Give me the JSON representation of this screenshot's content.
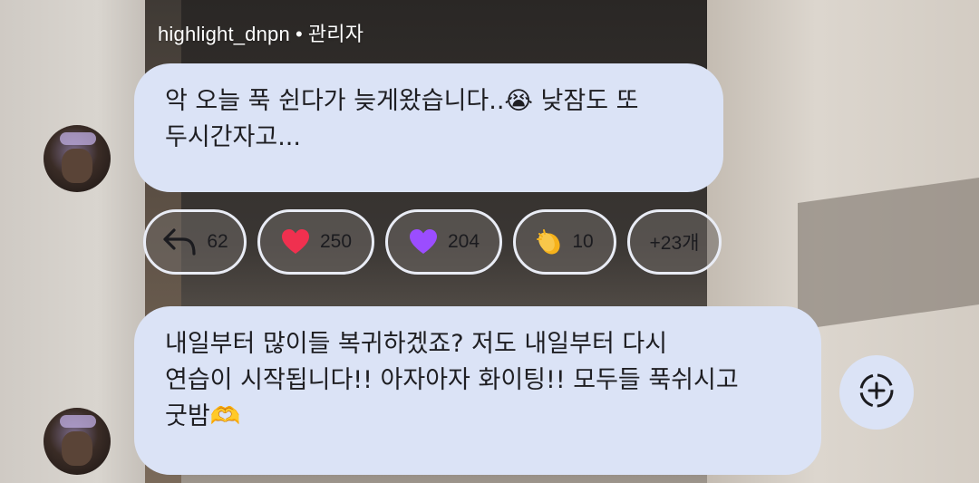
{
  "message_group": {
    "sender_name": "highlight_dnpn",
    "separator": "•",
    "sender_role": "관리자"
  },
  "messages": [
    {
      "line1": "악 오늘 푹 쉰다가 늦게왔습니다..😭 낮잠도 또",
      "line2": "두시간자고..."
    },
    {
      "line1": "내일부터 많이들 복귀하겠죠? 저도 내일부터 다시",
      "line2": "연습이 시작됩니다!! 아자아자 화이팅!! 모두들 푹쉬시고",
      "line3": "굿밤🫶"
    }
  ],
  "reactions": [
    {
      "icon": "reply-icon",
      "count": "62"
    },
    {
      "icon": "red-heart-icon",
      "count": "250",
      "color": "#f0304f"
    },
    {
      "icon": "purple-heart-icon",
      "count": "204",
      "color": "#9b4dff"
    },
    {
      "icon": "clapping-hands-icon",
      "count": "10",
      "color": "#f6b21b"
    },
    {
      "icon": "",
      "count": "+23개"
    }
  ],
  "colors": {
    "bubble": "#dbe3f6",
    "chip_border": "#e9ecf5"
  },
  "add_reaction": {
    "icon": "add-reaction-icon"
  }
}
